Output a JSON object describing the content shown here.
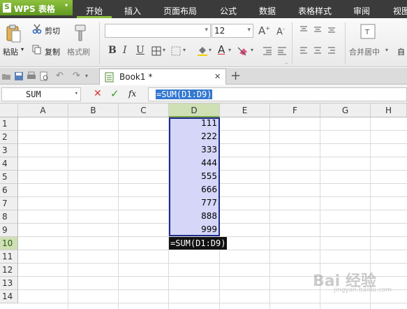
{
  "app": {
    "logo": "S",
    "name": "WPS 表格",
    "caret": "▾"
  },
  "menu": {
    "tabs": [
      {
        "label": "开始"
      },
      {
        "label": "插入"
      },
      {
        "label": "页面布局"
      },
      {
        "label": "公式"
      },
      {
        "label": "数据"
      },
      {
        "label": "表格样式"
      },
      {
        "label": "审阅"
      },
      {
        "label": "视图"
      }
    ],
    "active": "开始"
  },
  "ribbon": {
    "paste": "粘贴",
    "cut": "剪切",
    "copy": "复制",
    "format_painter": "格式刷",
    "font_name": "",
    "font_size": "12",
    "bold": "B",
    "italic": "I",
    "underline": "U",
    "merge_center": "合并居中",
    "auto_wrap_partial": "自"
  },
  "tabstrip": {
    "book_tab": "Book1 *",
    "close": "✕",
    "new_tab": "+"
  },
  "formula_bar": {
    "name_box": "SUM",
    "fx": "fx",
    "formula": "=SUM(D1:D9)"
  },
  "sheet": {
    "columns": [
      "A",
      "B",
      "C",
      "D",
      "E",
      "F",
      "G",
      "H"
    ],
    "rows": [
      "1",
      "2",
      "3",
      "4",
      "5",
      "6",
      "7",
      "8",
      "9",
      "10",
      "11",
      "12",
      "13",
      "14"
    ],
    "d_values": [
      "111",
      "222",
      "333",
      "444",
      "555",
      "666",
      "777",
      "888",
      "999"
    ],
    "active_column": "D",
    "active_row": "10",
    "editing_cell": "=SUM(D1:D9)"
  },
  "watermark": {
    "text": "Bai 经验",
    "sub": "jingyan.baidu.com"
  },
  "colors": {
    "accent_green": "#8fc13f",
    "menu_bg": "#3b3b3b",
    "selection_fill": "#d6d6f8",
    "selection_border": "#1c2c8c"
  }
}
